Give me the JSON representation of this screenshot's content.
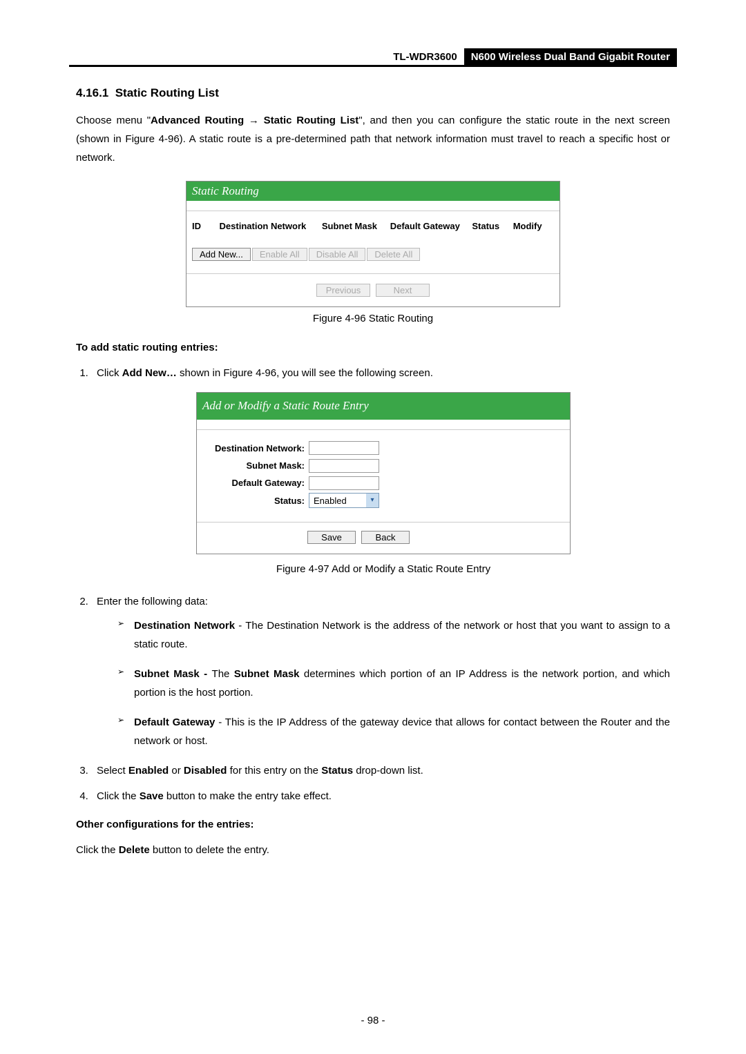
{
  "header": {
    "model": "TL-WDR3600",
    "product": "N600 Wireless Dual Band Gigabit Router"
  },
  "section": {
    "number": "4.16.1",
    "title": "Static Routing List"
  },
  "intro": {
    "t1": "Choose menu \"",
    "b1": "Advanced Routing",
    "arrow": " → ",
    "b2": "Static Routing List",
    "t2": "\", and then you can configure the static route in the next screen (shown in Figure 4-96). A static route is a pre-determined path that network information must travel to reach a specific host or network."
  },
  "panel1": {
    "title": "Static Routing",
    "cols": [
      "ID",
      "Destination Network",
      "Subnet Mask",
      "Default Gateway",
      "Status",
      "Modify"
    ],
    "buttons": {
      "add": "Add New...",
      "enable": "Enable All",
      "disable": "Disable All",
      "delete": "Delete All",
      "prev": "Previous",
      "next": "Next"
    }
  },
  "caption1": "Figure 4-96 Static Routing",
  "add_heading": "To add static routing entries:",
  "step1": {
    "t1": "Click ",
    "b1": "Add New…",
    "t2": " shown in Figure 4-96, you will see the following screen."
  },
  "panel2": {
    "title": "Add or Modify a Static Route Entry",
    "labels": {
      "dest": "Destination Network:",
      "mask": "Subnet Mask:",
      "gw": "Default Gateway:",
      "status": "Status:"
    },
    "status_value": "Enabled",
    "buttons": {
      "save": "Save",
      "back": "Back"
    }
  },
  "caption2": "Figure 4-97 Add or Modify a Static Route Entry",
  "step2": "Enter the following data:",
  "bullets": {
    "dest": {
      "b": "Destination Network",
      "t": " - The Destination Network is the address of the network or host that you want to assign to a static route."
    },
    "mask": {
      "b": "Subnet Mask - ",
      "t1": "The ",
      "b2": "Subnet Mask",
      "t2": " determines which portion of an IP Address is the network portion, and which portion is the host portion."
    },
    "gw": {
      "b": "Default Gateway",
      "t": " - This is the IP Address of the gateway device that allows for contact between the Router and the network or host."
    }
  },
  "step3": {
    "t1": "Select ",
    "b1": "Enabled",
    "t2": " or ",
    "b2": "Disabled",
    "t3": " for this entry on the ",
    "b3": "Status",
    "t4": " drop-down list."
  },
  "step4": {
    "t1": "Click the ",
    "b1": "Save",
    "t2": " button to make the entry take effect."
  },
  "other_heading": "Other configurations for the entries:",
  "other_text": {
    "t1": "Click the ",
    "b1": "Delete",
    "t2": " button to delete the entry."
  },
  "page_number": "- 98 -"
}
